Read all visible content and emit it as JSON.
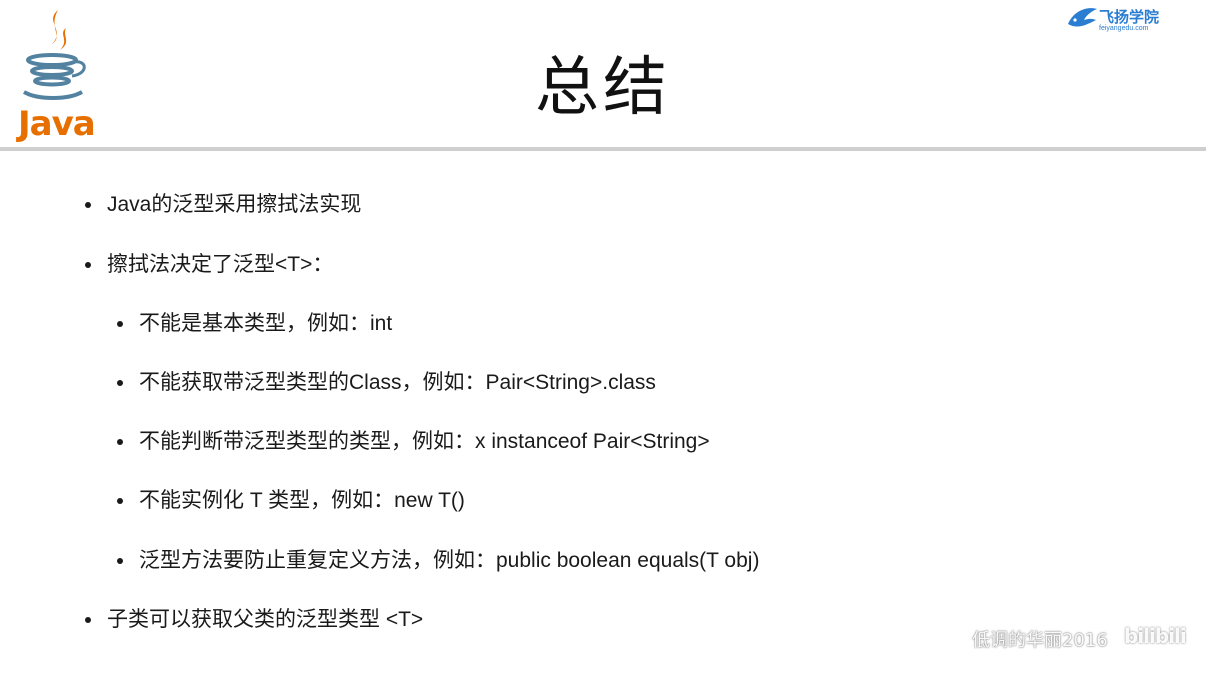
{
  "header": {
    "java_logo_text": "Java",
    "title": "总结",
    "brand": {
      "name": "飞扬学院",
      "url": "feiyangedu.com"
    }
  },
  "bullets": [
    {
      "level": 1,
      "text": "Java的泛型采用擦拭法实现"
    },
    {
      "level": 1,
      "text": "擦拭法决定了泛型<T>："
    },
    {
      "level": 2,
      "text": "不能是基本类型，例如：int"
    },
    {
      "level": 2,
      "text": "不能获取带泛型类型的Class，例如：Pair<String>.class"
    },
    {
      "level": 2,
      "text": "不能判断带泛型类型的类型，例如：x instanceof Pair<String>"
    },
    {
      "level": 2,
      "text": "不能实例化 T 类型，例如：new T()"
    },
    {
      "level": 2,
      "text": "泛型方法要防止重复定义方法，例如：public boolean equals(T obj)"
    },
    {
      "level": 1,
      "text": "子类可以获取父类的泛型类型 <T>"
    }
  ],
  "watermark": {
    "text": "低调的华丽2016",
    "platform": "bilibili"
  },
  "colors": {
    "java_orange": "#e76f00",
    "java_blue": "#5382a1",
    "brand_blue": "#2b7dd2",
    "rule_gray": "#cfcfcf"
  }
}
